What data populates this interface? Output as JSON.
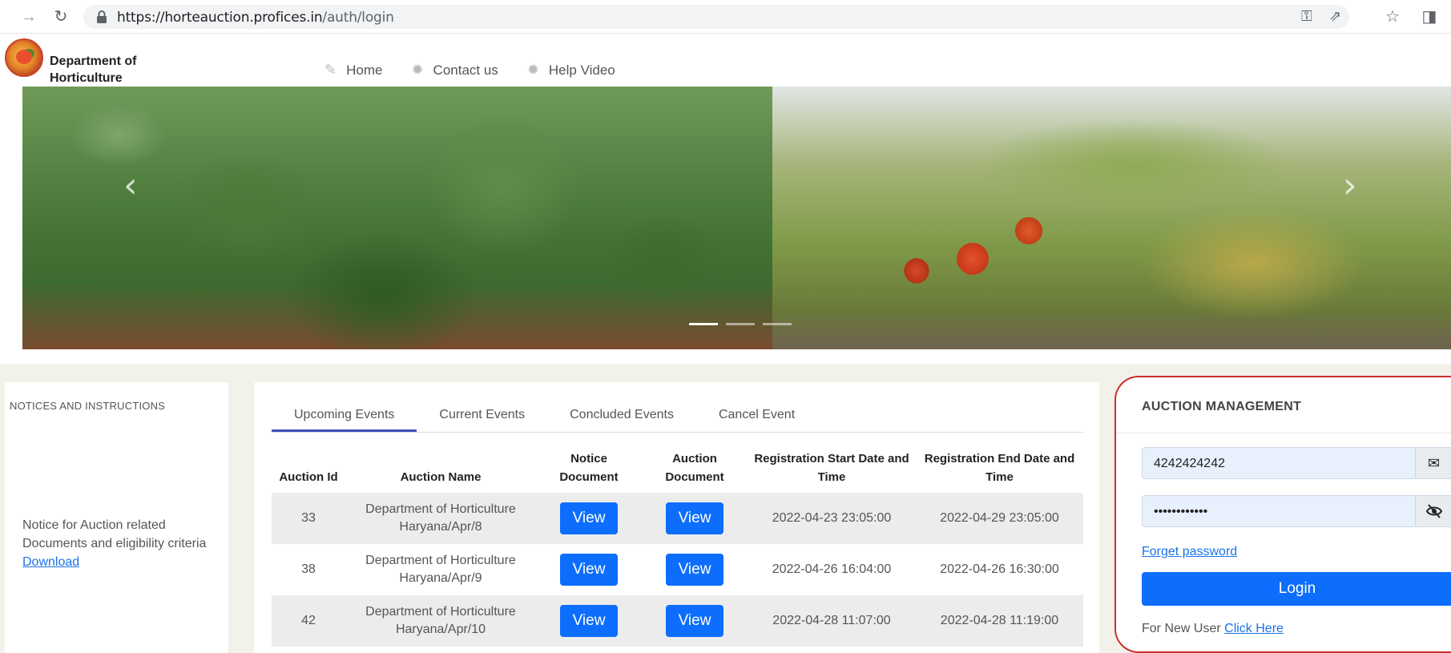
{
  "browser": {
    "url_host": "https://horteauction.proficeс.in",
    "url_host_text": "https://horteauction.profices.in",
    "url_path": "/auth/login",
    "icons": [
      "back-arrow-icon",
      "reload-icon",
      "lock-icon",
      "key-icon",
      "share-icon",
      "star-icon",
      "sidebar-icon"
    ]
  },
  "header": {
    "brand_line1": "Department of",
    "brand_line2": "Horticulture",
    "nav": [
      {
        "label": "Home",
        "icon": "edit-icon"
      },
      {
        "label": "Contact us",
        "icon": "gear-icon"
      },
      {
        "label": "Help Video",
        "icon": "gear-icon"
      }
    ]
  },
  "carousel": {
    "prev": "‹",
    "next": "›",
    "active_index": 1,
    "slide_count": 3
  },
  "notices": {
    "title": "NOTICES AND INSTRUCTIONS",
    "text": "Notice for Auction related Documents and eligibility criteria",
    "link": "Download"
  },
  "events": {
    "tabs": [
      "Upcoming Events",
      "Current Events",
      "Concluded Events",
      "Cancel Event"
    ],
    "active_tab": "Upcoming Events",
    "columns": {
      "id": "Auction Id",
      "name": "Auction Name",
      "notice": "Notice Document",
      "auction_doc": "Auction Document",
      "reg_start": "Registration Start Date and Time",
      "reg_end": "Registration End Date and Time"
    },
    "rows": [
      {
        "id": "33",
        "name": "Department of Horticulture Haryana/Apr/8",
        "notice": "View",
        "auction_doc": "View",
        "reg_start": "2022-04-23 23:05:00",
        "reg_end": "2022-04-29 23:05:00"
      },
      {
        "id": "38",
        "name": "Department of Horticulture Haryana/Apr/9",
        "notice": "View",
        "auction_doc": "View",
        "reg_start": "2022-04-26 16:04:00",
        "reg_end": "2022-04-26 16:30:00"
      },
      {
        "id": "42",
        "name": "Department of Horticulture Haryana/Apr/10",
        "notice": "View",
        "auction_doc": "View",
        "reg_start": "2022-04-28 11:07:00",
        "reg_end": "2022-04-28 11:19:00"
      }
    ]
  },
  "auction": {
    "title": "AUCTION MANAGEMENT",
    "username_value": "4242424242",
    "password_value": "••••••••••••",
    "email_icon": "✉",
    "eye_icon": "👁",
    "forgot": "Forget password",
    "login": "Login",
    "new_user_text": "For New User",
    "new_user_link": "Click Here"
  }
}
